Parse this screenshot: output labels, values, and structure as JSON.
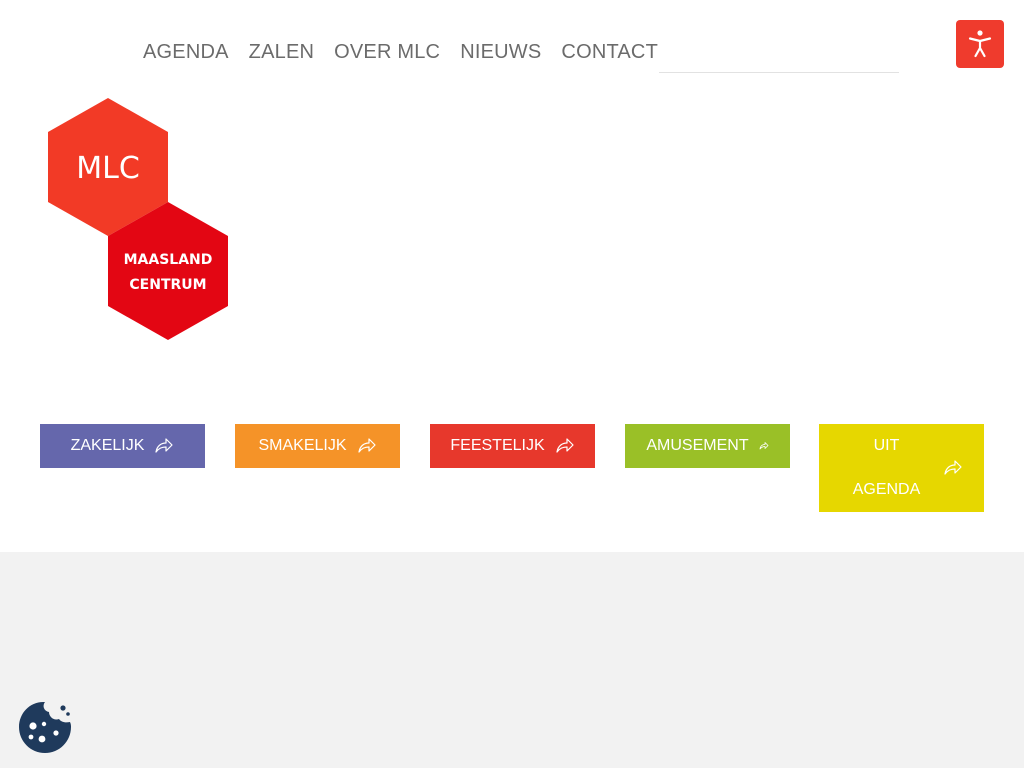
{
  "nav": {
    "items": [
      {
        "label": "AGENDA"
      },
      {
        "label": "ZALEN"
      },
      {
        "label": "OVER MLC"
      },
      {
        "label": "NIEUWS"
      },
      {
        "label": "CONTACT"
      }
    ]
  },
  "search": {
    "placeholder": ""
  },
  "logo": {
    "line1": "MLC",
    "line2": "MAASLAND",
    "line3": "CENTRUM"
  },
  "categories": [
    {
      "label": "ZAKELIJK",
      "color": "#6567ac"
    },
    {
      "label": "SMAKELIJK",
      "color": "#f59328"
    },
    {
      "label": "FEESTELIJK",
      "color": "#e7382c"
    },
    {
      "label": "AMUSEMENT",
      "color": "#9ac027"
    },
    {
      "label": "UIT AGENDA",
      "color": "#e6d700"
    }
  ],
  "colors": {
    "accessibility_button": "#ef3b2d",
    "logo_top_hex": "#f23a26",
    "logo_bottom_hex": "#e30613",
    "cookie_icon": "#1f3a5c",
    "footer_background": "#f2f2f2"
  },
  "icons": {
    "accessibility": "accessibility-person-icon",
    "tile_arrow": "share-arrow-icon",
    "cookie": "cookie-icon"
  }
}
